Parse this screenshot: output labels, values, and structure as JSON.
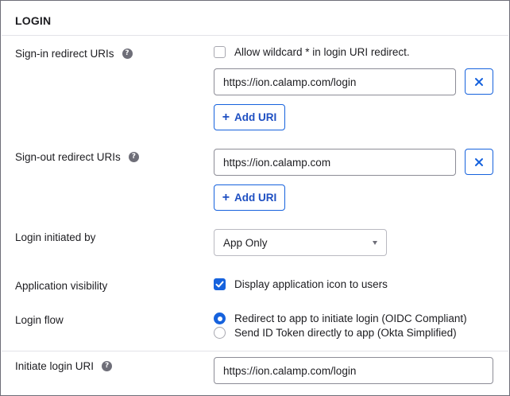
{
  "section": {
    "title": "LOGIN"
  },
  "sign_in": {
    "label": "Sign-in redirect URIs",
    "help": "?",
    "wildcard_label": "Allow wildcard * in login URI redirect.",
    "wildcard_checked": false,
    "uri_value": "https://ion.calamp.com/login",
    "add_label": "Add URI"
  },
  "sign_out": {
    "label": "Sign-out redirect URIs",
    "help": "?",
    "uri_value": "https://ion.calamp.com",
    "add_label": "Add URI"
  },
  "login_initiated": {
    "label": "Login initiated by",
    "selected": "App Only"
  },
  "visibility": {
    "label": "Application visibility",
    "option_label": "Display application icon to users",
    "checked": true
  },
  "login_flow": {
    "label": "Login flow",
    "options": [
      {
        "label": "Redirect to app to initiate login (OIDC Compliant)",
        "selected": true
      },
      {
        "label": "Send ID Token directly to app (Okta Simplified)",
        "selected": false
      }
    ]
  },
  "initiate_uri": {
    "label": "Initiate login URI",
    "help": "?",
    "value": "https://ion.calamp.com/login"
  },
  "colors": {
    "accent": "#1662dd",
    "border": "#8c8c96",
    "text": "#1d1d21"
  }
}
